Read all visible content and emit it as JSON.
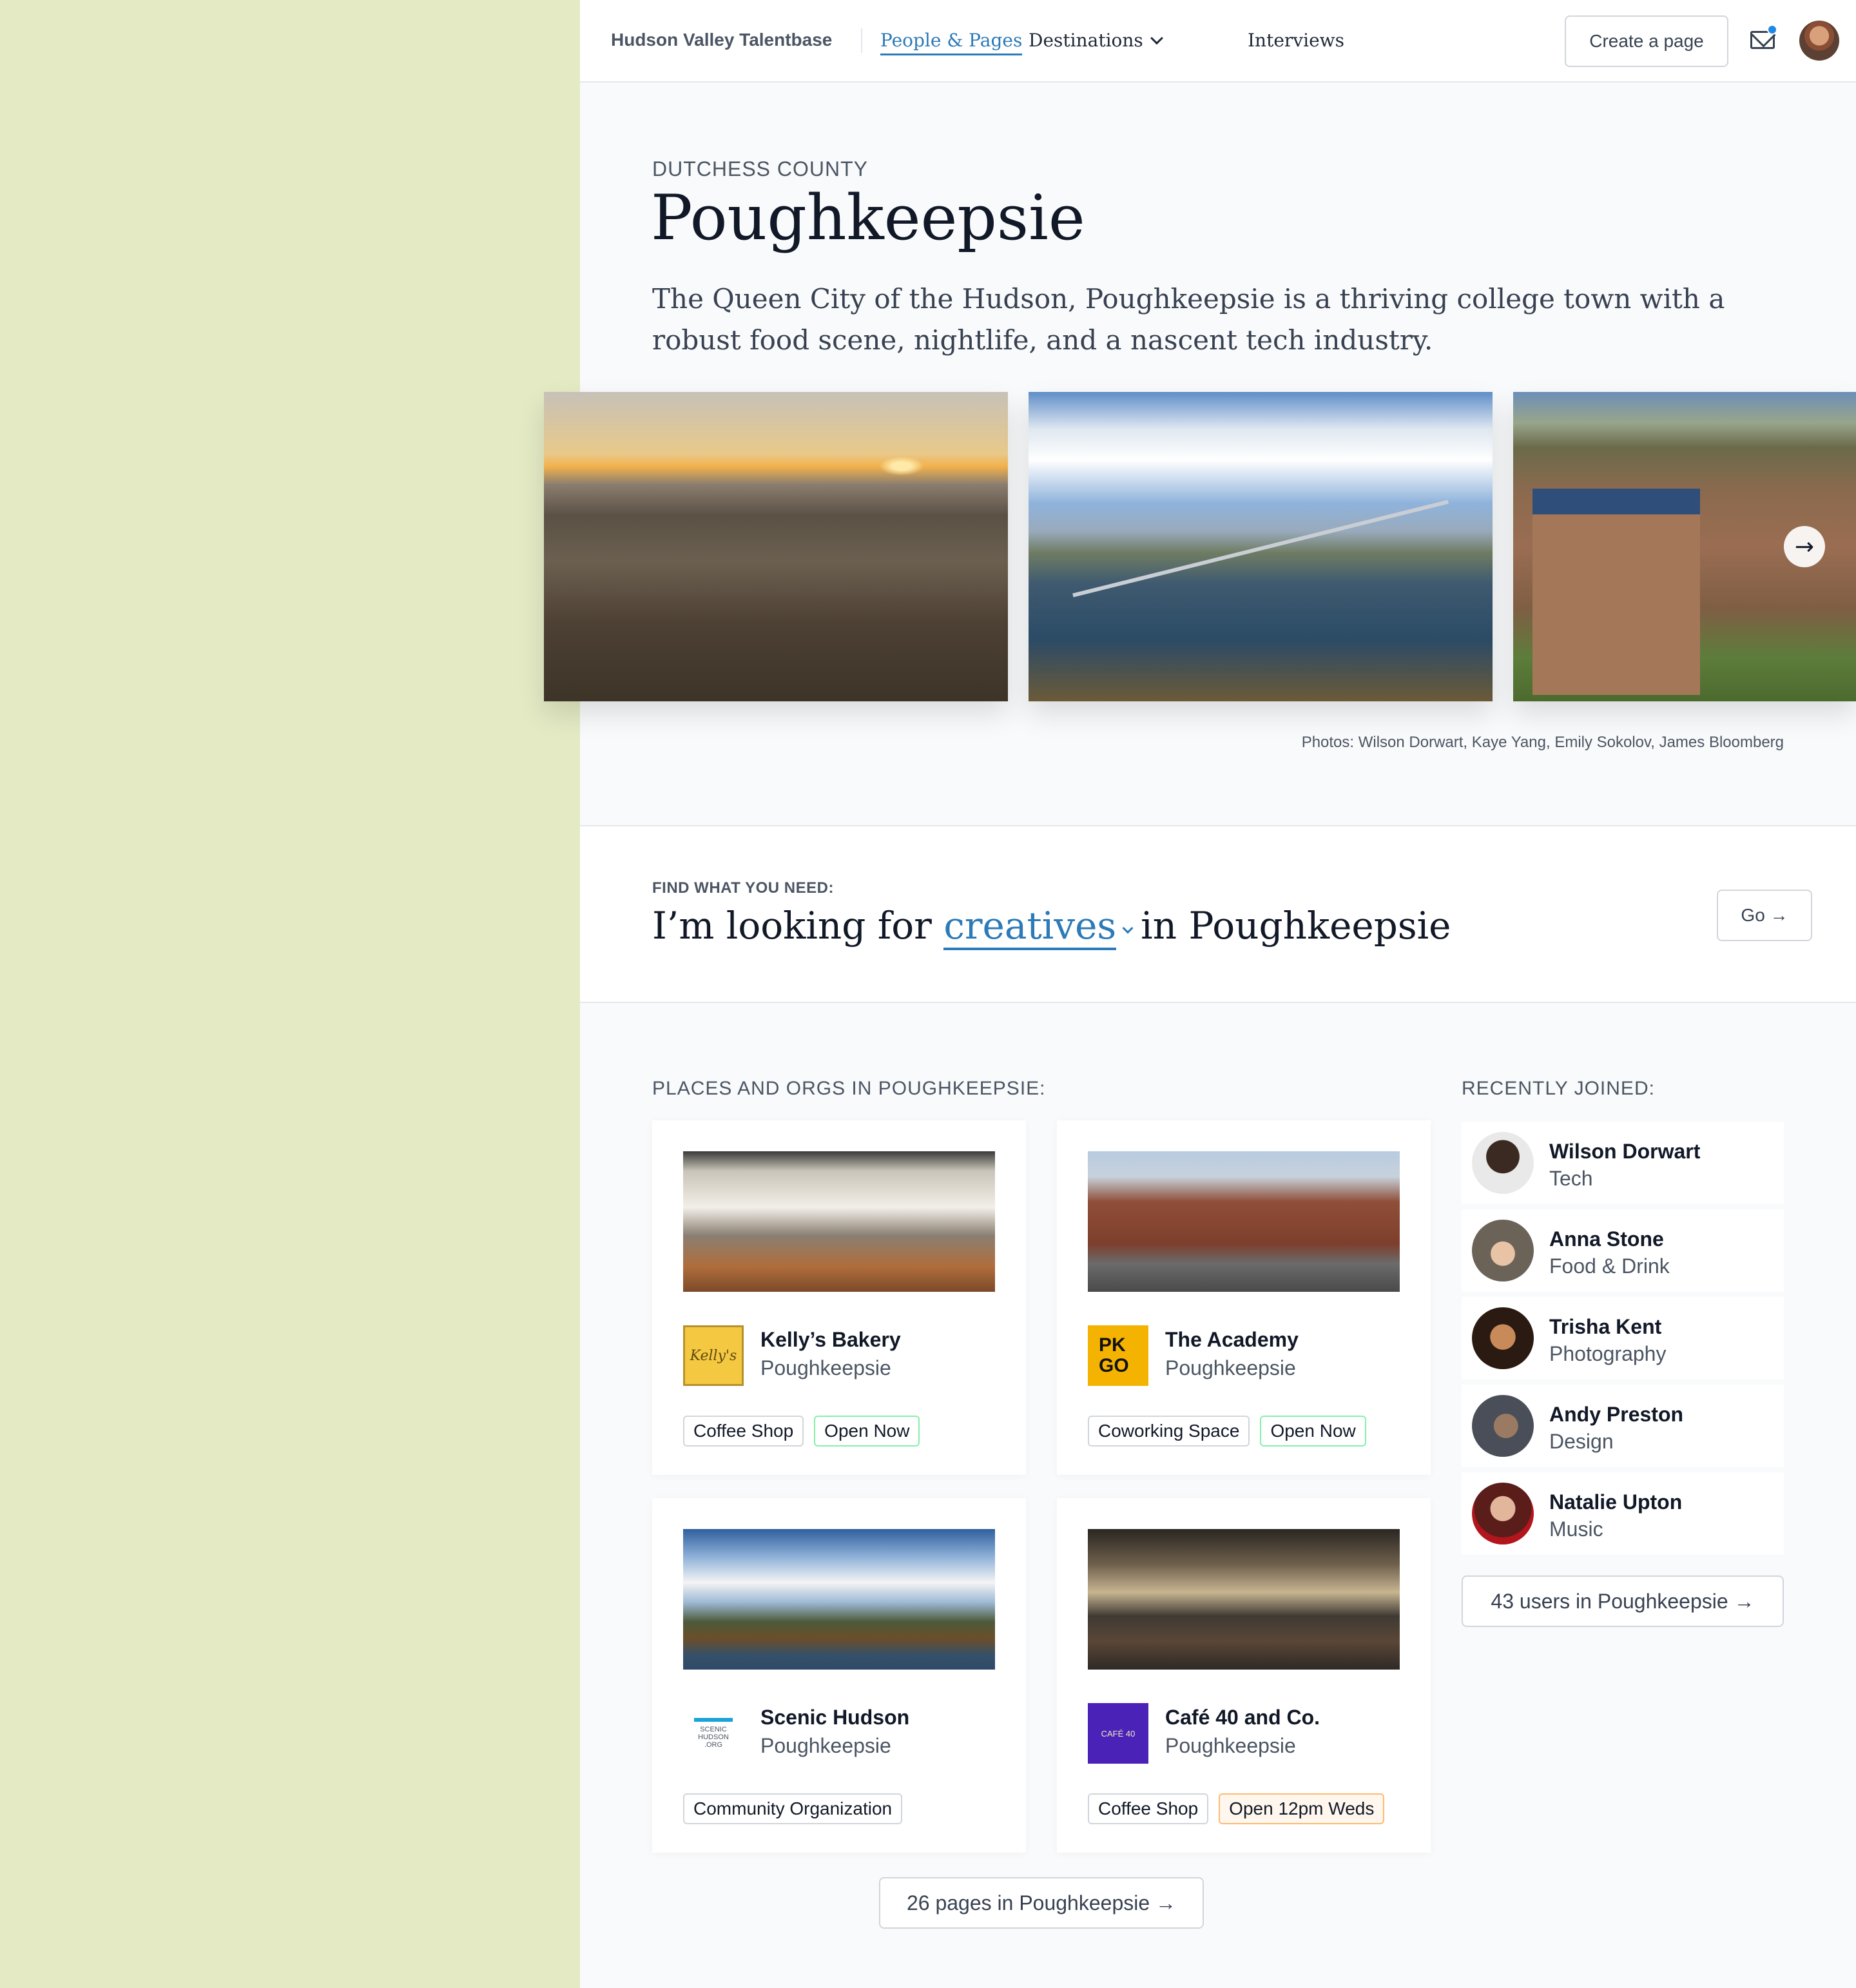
{
  "nav": {
    "brand": "Hudson Valley Talentbase",
    "links": [
      "People & Pages",
      "Destinations",
      "Interviews"
    ],
    "create_button": "Create a page"
  },
  "hero": {
    "eyebrow": "DUTCHESS COUNTY",
    "title": "Poughkeepsie",
    "description": "The Queen City of the Hudson, Poughkeepsie is a thriving college town with a robust food scene, nightlife, and a nascent tech industry.",
    "photo_credit": "Photos: Wilson Dorwart, Kaye Yang, Emily Sokolov, James Bloomberg"
  },
  "find": {
    "label": "FIND WHAT YOU NEED:",
    "prefix": "I’m looking for",
    "selected": "creatives",
    "suffix": "in Poughkeepsie",
    "go_button": "Go →"
  },
  "places": {
    "heading": "PLACES AND ORGS IN POUGHKEEPSIE:",
    "cards": [
      {
        "name": "Kelly’s Bakery",
        "location": "Poughkeepsie",
        "logo_text": "Kelly's",
        "tags": [
          "Coffee Shop",
          "Open Now"
        ]
      },
      {
        "name": "The Academy",
        "location": "Poughkeepsie",
        "logo_text": "PK GO",
        "tags": [
          "Coworking Space",
          "Open Now"
        ]
      },
      {
        "name": "Scenic Hudson",
        "location": "Poughkeepsie",
        "logo_text": "SCENIC HUDSON .ORG",
        "tags": [
          "Community Organization"
        ]
      },
      {
        "name": "Café 40 and Co.",
        "location": "Poughkeepsie",
        "logo_text": "CAFÉ 40",
        "tags": [
          "Coffee Shop",
          "Open 12pm Weds"
        ]
      }
    ],
    "more_button": "26 pages in Poughkeepsie →"
  },
  "recent": {
    "heading": "RECENTLY JOINED:",
    "people": [
      {
        "name": "Wilson Dorwart",
        "role": "Tech"
      },
      {
        "name": "Anna Stone",
        "role": "Food & Drink"
      },
      {
        "name": "Trisha Kent",
        "role": "Photography"
      },
      {
        "name": "Andy Preston",
        "role": "Design"
      },
      {
        "name": "Natalie Upton",
        "role": "Music"
      }
    ],
    "more_button": "43 users in Poughkeepsie →"
  },
  "colors": {
    "accent": "#2c7ab8",
    "side_strip": "#e4eac4",
    "notification": "#1e88e5"
  },
  "icons": [
    "mail-icon",
    "chevron-down-icon",
    "arrow-right-icon",
    "user-avatar"
  ]
}
